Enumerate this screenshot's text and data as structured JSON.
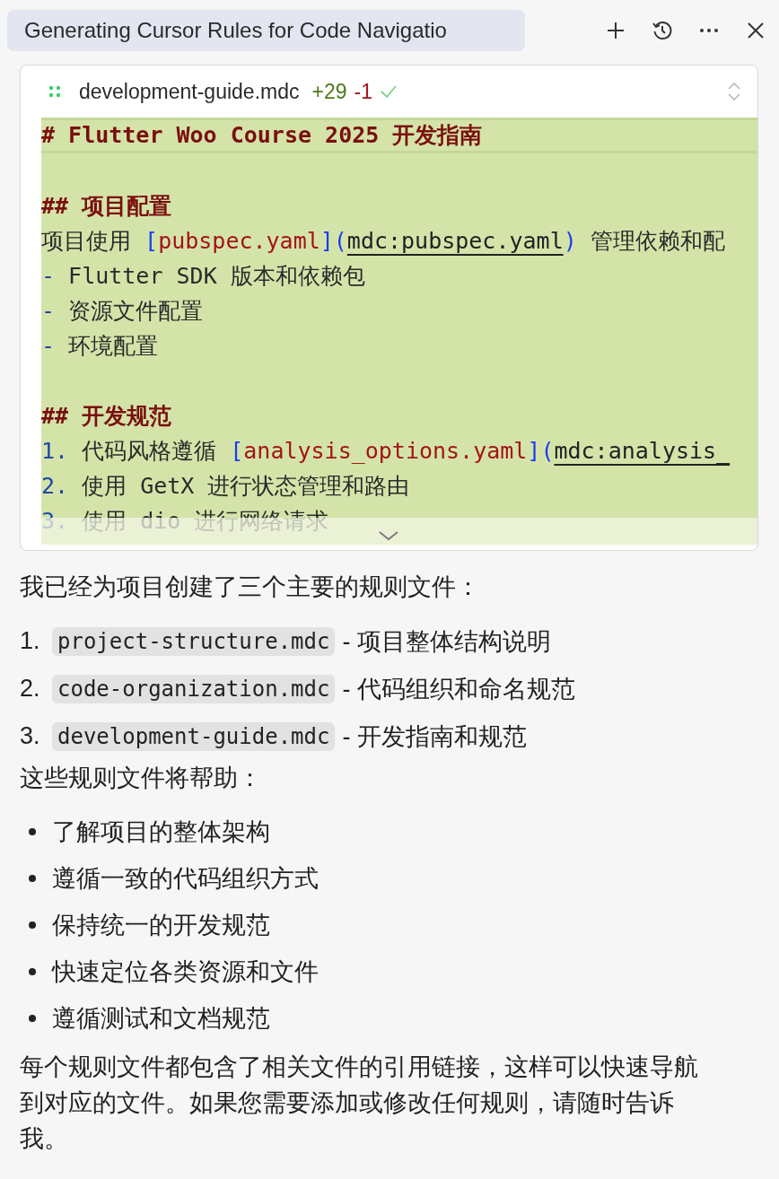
{
  "tab": {
    "title": "Generating Cursor Rules for Code Navigatio"
  },
  "toolbar": [
    {
      "kind": "plus"
    },
    {
      "kind": "history"
    },
    {
      "kind": "more"
    },
    {
      "kind": "close"
    }
  ],
  "file_card": {
    "filename": "development-guide.mdc",
    "added": "+29",
    "removed": "-1",
    "applied": true,
    "lines": [
      {
        "kind": "title",
        "segments": [
          {
            "kind": "heading",
            "text": "# Flutter Woo Course 2025 开发指南"
          }
        ]
      },
      {
        "kind": "blank"
      },
      {
        "kind": "normal",
        "segments": [
          {
            "kind": "heading",
            "text": "## 项目配置"
          }
        ]
      },
      {
        "kind": "normal",
        "segments": [
          {
            "kind": "text",
            "text": "项目使用 "
          },
          {
            "kind": "bracket",
            "text": "["
          },
          {
            "kind": "linktext",
            "text": "pubspec.yaml"
          },
          {
            "kind": "bracket",
            "text": "]("
          },
          {
            "kind": "url",
            "text": "mdc:pubspec.yaml"
          },
          {
            "kind": "bracket",
            "text": ")"
          },
          {
            "kind": "text",
            "text": " 管理依赖和配"
          }
        ]
      },
      {
        "kind": "normal",
        "segments": [
          {
            "kind": "marker",
            "text": "-"
          },
          {
            "kind": "text",
            "text": " Flutter SDK 版本和依赖包"
          }
        ]
      },
      {
        "kind": "normal",
        "segments": [
          {
            "kind": "marker",
            "text": "-"
          },
          {
            "kind": "text",
            "text": " 资源文件配置"
          }
        ]
      },
      {
        "kind": "normal",
        "segments": [
          {
            "kind": "marker",
            "text": "-"
          },
          {
            "kind": "text",
            "text": " 环境配置"
          }
        ]
      },
      {
        "kind": "blank"
      },
      {
        "kind": "normal",
        "segments": [
          {
            "kind": "heading",
            "text": "## 开发规范"
          }
        ]
      },
      {
        "kind": "normal",
        "segments": [
          {
            "kind": "marker",
            "text": "1."
          },
          {
            "kind": "text",
            "text": " 代码风格遵循 "
          },
          {
            "kind": "bracket",
            "text": "["
          },
          {
            "kind": "linktext",
            "text": "analysis_options.yaml"
          },
          {
            "kind": "bracket",
            "text": "]("
          },
          {
            "kind": "url",
            "text": "mdc:analysis_"
          }
        ]
      },
      {
        "kind": "normal",
        "segments": [
          {
            "kind": "marker",
            "text": "2."
          },
          {
            "kind": "text",
            "text": " 使用 GetX 进行状态管理和路由"
          }
        ]
      },
      {
        "kind": "normal",
        "segments": [
          {
            "kind": "marker",
            "text": "3."
          },
          {
            "kind": "text",
            "text": " 使用 dio 进行网络请求"
          }
        ]
      }
    ]
  },
  "message": [
    {
      "kind": "paragraph",
      "text": "我已经为项目创建了三个主要的规则文件："
    },
    {
      "kind": "numbered",
      "number": "1.",
      "code": "project-structure.mdc",
      "text": "- 项目整体结构说明"
    },
    {
      "kind": "numbered",
      "number": "2.",
      "code": "code-organization.mdc",
      "text": "- 代码组织和命名规范"
    },
    {
      "kind": "numbered",
      "number": "3.",
      "code": "development-guide.mdc",
      "text": "- 开发指南和规范"
    },
    {
      "kind": "paragraph",
      "text": "这些规则文件将帮助："
    },
    {
      "kind": "bullet",
      "text": "了解项目的整体架构"
    },
    {
      "kind": "bullet",
      "text": "遵循一致的代码组织方式"
    },
    {
      "kind": "bullet",
      "text": "保持统一的开发规范"
    },
    {
      "kind": "bullet",
      "text": "快速定位各类资源和文件"
    },
    {
      "kind": "bullet",
      "text": "遵循测试和文档规范"
    },
    {
      "kind": "paragraph",
      "text": "每个规则文件都包含了相关文件的引用链接，这样可以快速导航到对应的文件。如果您需要添加或修改任何规则，请随时告诉我。"
    }
  ]
}
